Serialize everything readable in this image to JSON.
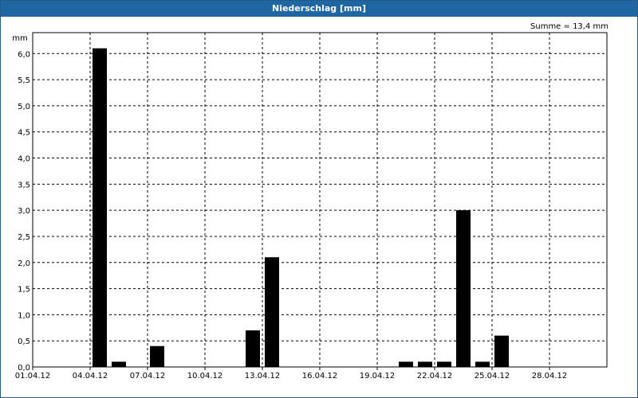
{
  "window": {
    "title": "Niederschlag [mm]"
  },
  "chart_data": {
    "type": "bar",
    "title": "Niederschlag [mm]",
    "ylabel": "mm",
    "annotation": "Summe = 13,4 mm",
    "ylim": [
      0,
      6.4
    ],
    "xlim_days": [
      1,
      31
    ],
    "grid": true,
    "bar_color": "#000000",
    "x_ticks": [
      "01.04.12",
      "04.04.12",
      "07.04.12",
      "10.04.12",
      "13.04.12",
      "16.04.12",
      "19.04.12",
      "22.04.12",
      "25.04.12",
      "28.04.12"
    ],
    "y_ticks": [
      "0,0",
      "0,5",
      "1,0",
      "1,5",
      "2,0",
      "2,5",
      "3,0",
      "3,5",
      "4,0",
      "4,5",
      "5,0",
      "5,5",
      "6,0"
    ],
    "categories": [
      "04.04.12",
      "05.04.12",
      "07.04.12",
      "12.04.12",
      "13.04.12",
      "20.04.12",
      "21.04.12",
      "22.04.12",
      "23.04.12",
      "24.04.12",
      "25.04.12"
    ],
    "values": [
      6.1,
      0.1,
      0.4,
      0.7,
      2.1,
      0.1,
      0.1,
      0.1,
      3.0,
      0.1,
      0.6
    ]
  }
}
